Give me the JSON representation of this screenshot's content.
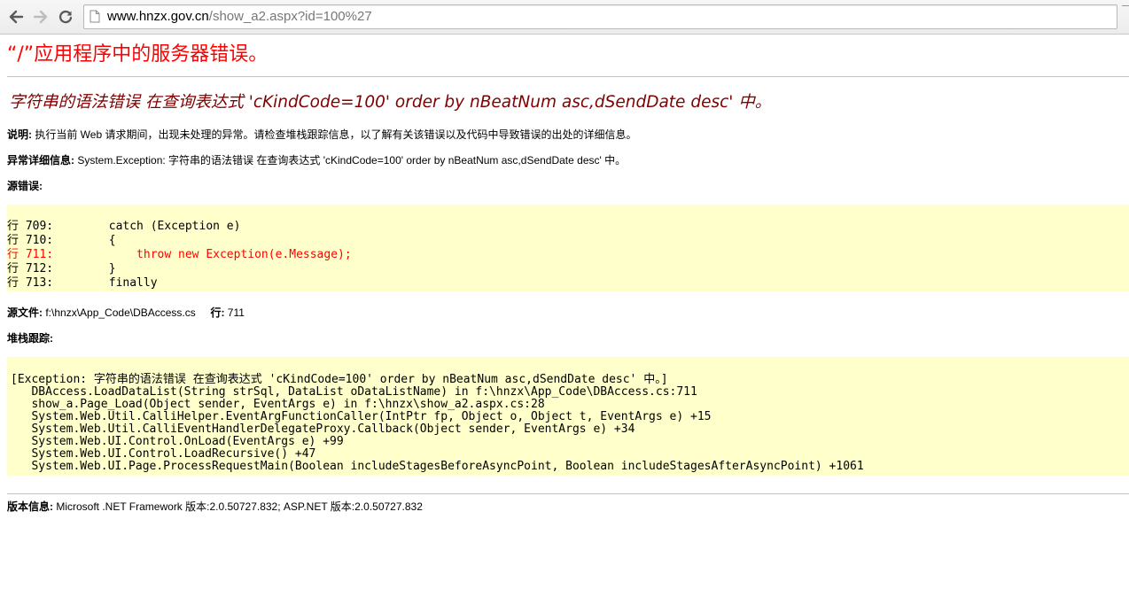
{
  "browser": {
    "url_host": "www.hnzx.gov.cn",
    "url_path": "/show_a2.aspx?id=100%27"
  },
  "error_page": {
    "server_error_title": "“/”应用程序中的服务器错误。",
    "error_message": "字符串的语法错误 在查询表达式 'cKindCode=100' order by nBeatNum asc,dSendDate desc' 中。",
    "description": {
      "label": "说明:",
      "text": "执行当前 Web 请求期间，出现未处理的异常。请检查堆栈跟踪信息，以了解有关该错误以及代码中导致错误的出处的详细信息。"
    },
    "exception_details": {
      "label": "异常详细信息:",
      "text": "System.Exception: 字符串的语法错误 在查询表达式 'cKindCode=100' order by nBeatNum asc,dSendDate desc' 中。"
    },
    "source_error_label": "源错误:",
    "source_lines": [
      "行 709:        catch (Exception e)",
      "行 710:        {",
      "行 711:            throw new Exception(e.Message);",
      "行 712:        }",
      "行 713:        finally"
    ],
    "source_file": {
      "label": "源文件:",
      "path": "f:\\hnzx\\App_Code\\DBAccess.cs",
      "line_label": "行:",
      "line_number": "711"
    },
    "stack_trace_label": "堆栈跟踪:",
    "stack_lines": [
      "[Exception: 字符串的语法错误 在查询表达式 'cKindCode=100' order by nBeatNum asc,dSendDate desc' 中。]",
      "   DBAccess.LoadDataList(String strSql, DataList oDataListName) in f:\\hnzx\\App_Code\\DBAccess.cs:711",
      "   show_a.Page_Load(Object sender, EventArgs e) in f:\\hnzx\\show_a2.aspx.cs:28",
      "   System.Web.Util.CalliHelper.EventArgFunctionCaller(IntPtr fp, Object o, Object t, EventArgs e) +15",
      "   System.Web.Util.CalliEventHandlerDelegateProxy.Callback(Object sender, EventArgs e) +34",
      "   System.Web.UI.Control.OnLoad(EventArgs e) +99",
      "   System.Web.UI.Control.LoadRecursive() +47",
      "   System.Web.UI.Page.ProcessRequestMain(Boolean includeStagesBeforeAsyncPoint, Boolean includeStagesAfterAsyncPoint) +1061"
    ],
    "version": {
      "label": "版本信息:",
      "text": "Microsoft .NET Framework 版本:2.0.50727.832; ASP.NET 版本:2.0.50727.832"
    }
  }
}
